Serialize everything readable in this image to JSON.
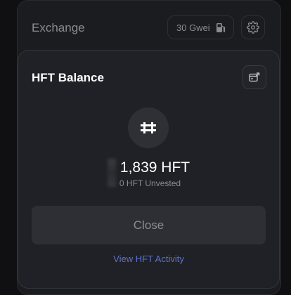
{
  "exchange": {
    "title": "Exchange",
    "gas_price": "30 Gwei"
  },
  "modal": {
    "title": "HFT Balance",
    "balance": "1,839 HFT",
    "unvested": "0 HFT Unvested",
    "close_label": "Close",
    "activity_label": "View HFT Activity"
  },
  "icons": {
    "gas": "fuel-pump-icon",
    "settings": "gear-icon",
    "export": "export-icon",
    "token": "hft-token-icon"
  },
  "colors": {
    "link": "#5b73c8",
    "modal_bg": "#202126",
    "page_bg": "#101013"
  }
}
